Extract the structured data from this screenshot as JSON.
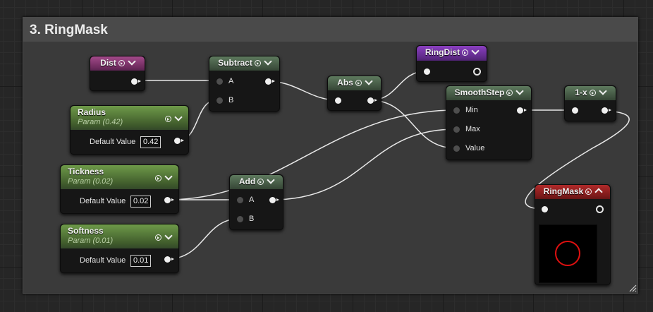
{
  "comment": {
    "title": "3. RingMask"
  },
  "nodes": {
    "dist": {
      "title": "Dist"
    },
    "subtract": {
      "title": "Subtract",
      "pin_a": "A",
      "pin_b": "B"
    },
    "abs": {
      "title": "Abs"
    },
    "ringdist": {
      "title": "RingDist"
    },
    "smoothstep": {
      "title": "SmoothStep",
      "pin_min": "Min",
      "pin_max": "Max",
      "pin_value": "Value"
    },
    "oneminus": {
      "title": "1-x"
    },
    "radius": {
      "title": "Radius",
      "subtitle": "Param (0.42)",
      "default_label": "Default Value",
      "default_value": "0.42"
    },
    "tickness": {
      "title": "Tickness",
      "subtitle": "Param (0.02)",
      "default_label": "Default Value",
      "default_value": "0.02"
    },
    "softness": {
      "title": "Softness",
      "subtitle": "Param (0.01)",
      "default_label": "Default Value",
      "default_value": "0.01"
    },
    "add": {
      "title": "Add",
      "pin_a": "A",
      "pin_b": "B"
    },
    "ringmask": {
      "title": "RingMask"
    }
  },
  "colors": {
    "preview_ring": "#e01010",
    "wire": "#e8e8e8"
  }
}
